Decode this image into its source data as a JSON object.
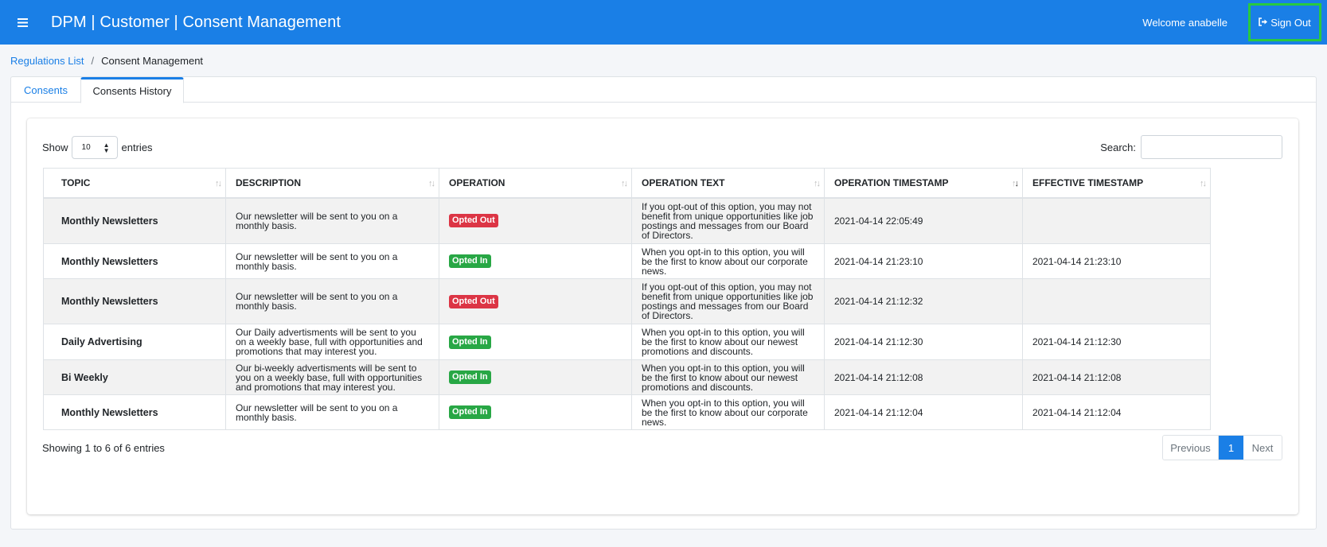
{
  "header": {
    "title": "DPM | Customer | Consent Management",
    "welcome": "Welcome anabelle",
    "signout_label": "Sign Out"
  },
  "breadcrumb": {
    "link": "Regulations List",
    "separator": "/",
    "current": "Consent Management"
  },
  "tabs": {
    "consents": "Consents",
    "history": "Consents History"
  },
  "table_controls": {
    "show_label": "Show",
    "page_length": "10",
    "entries_label": "entries",
    "search_label": "Search:",
    "search_value": ""
  },
  "table": {
    "headers": [
      "TOPIC",
      "DESCRIPTION",
      "OPERATION",
      "OPERATION TEXT",
      "OPERATION TIMESTAMP",
      "EFFECTIVE TIMESTAMP"
    ],
    "sorted_column": "OPERATION TIMESTAMP",
    "rows": [
      {
        "topic": "Monthly Newsletters",
        "description": "Our newsletter will be sent to you on a monthly basis.",
        "operation": "Opted Out",
        "operation_text": "If you opt-out of this option, you may not benefit from unique opportunities like job postings and messages from our Board of Directors.",
        "operation_timestamp": "2021-04-14 22:05:49",
        "effective_timestamp": ""
      },
      {
        "topic": "Monthly Newsletters",
        "description": "Our newsletter will be sent to you on a monthly basis.",
        "operation": "Opted In",
        "operation_text": "When you opt-in to this option, you will be the first to know about our corporate news.",
        "operation_timestamp": "2021-04-14 21:23:10",
        "effective_timestamp": "2021-04-14 21:23:10"
      },
      {
        "topic": "Monthly Newsletters",
        "description": "Our newsletter will be sent to you on a monthly basis.",
        "operation": "Opted Out",
        "operation_text": "If you opt-out of this option, you may not benefit from unique opportunities like job postings and messages from our Board of Directors.",
        "operation_timestamp": "2021-04-14 21:12:32",
        "effective_timestamp": ""
      },
      {
        "topic": "Daily Advertising",
        "description": "Our Daily advertisments will be sent to you on a weekly base, full with opportunities and promotions that may interest you.",
        "operation": "Opted In",
        "operation_text": "When you opt-in to this option, you will be the first to know about our newest promotions and discounts.",
        "operation_timestamp": "2021-04-14 21:12:30",
        "effective_timestamp": "2021-04-14 21:12:30"
      },
      {
        "topic": "Bi Weekly",
        "description": "Our bi-weekly advertisments will be sent to you on a weekly base, full with opportunities and promotions that may interest you.",
        "operation": "Opted In",
        "operation_text": "When you opt-in to this option, you will be the first to know about our newest promotions and discounts.",
        "operation_timestamp": "2021-04-14 21:12:08",
        "effective_timestamp": "2021-04-14 21:12:08"
      },
      {
        "topic": "Monthly Newsletters",
        "description": "Our newsletter will be sent to you on a monthly basis.",
        "operation": "Opted In",
        "operation_text": "When you opt-in to this option, you will be the first to know about our corporate news.",
        "operation_timestamp": "2021-04-14 21:12:04",
        "effective_timestamp": "2021-04-14 21:12:04"
      }
    ]
  },
  "footer": {
    "info": "Showing 1 to 6 of 6 entries",
    "previous": "Previous",
    "page": "1",
    "next": "Next"
  },
  "colors": {
    "primary": "#1a7fe6",
    "opted_out": "#dc3545",
    "opted_in": "#28a745",
    "signout_highlight": "#28c940"
  }
}
